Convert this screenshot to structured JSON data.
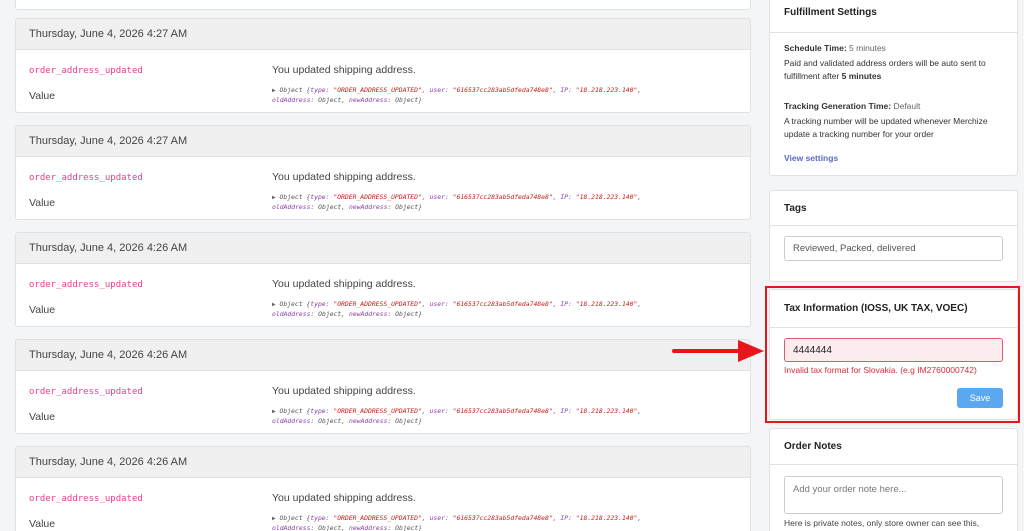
{
  "log": {
    "entries": [
      {
        "timestamp": "Thursday, June 4, 2026 4:27 AM",
        "event": "order_address_updated",
        "value_label": "Value",
        "description": "You updated shipping address."
      },
      {
        "timestamp": "Thursday, June 4, 2026 4:27 AM",
        "event": "order_address_updated",
        "value_label": "Value",
        "description": "You updated shipping address."
      },
      {
        "timestamp": "Thursday, June 4, 2026 4:26 AM",
        "event": "order_address_updated",
        "value_label": "Value",
        "description": "You updated shipping address."
      },
      {
        "timestamp": "Thursday, June 4, 2026 4:26 AM",
        "event": "order_address_updated",
        "value_label": "Value",
        "description": "You updated shipping address."
      },
      {
        "timestamp": "Thursday, June 4, 2026 4:26 AM",
        "event": "order_address_updated",
        "value_label": "Value",
        "description": "You updated shipping address."
      }
    ],
    "object_preview": {
      "prefix": "Object {",
      "type_key": "type: ",
      "type_val": "\"ORDER_ADDRESS_UPDATED\"",
      "user_key": ", user: ",
      "user_val": "\"616537cc283ab5dfeda748e8\"",
      "ip_key": ", IP: ",
      "ip_val": "\"18.218.223.140\"",
      "line2_old_key": "oldAddress",
      "line2_old_val": ": Object, ",
      "line2_new_key": "newAddress",
      "line2_new_val": ": Object}"
    }
  },
  "fulfillment": {
    "title": "Fulfillment Settings",
    "schedule_label": "Schedule Time:",
    "schedule_value": "5 minutes",
    "schedule_desc_prefix": "Paid and validated address orders will be auto sent to fulfillment after",
    "schedule_desc_bold": "5 minutes",
    "tracking_label": "Tracking Generation Time:",
    "tracking_value": "Default",
    "tracking_desc": "A tracking number will be updated whenever Merchize update a tracking number for your order",
    "view_settings": "View settings"
  },
  "tags": {
    "title": "Tags",
    "value": "Reviewed, Packed, delivered"
  },
  "tax": {
    "title": "Tax Information (IOSS, UK TAX, VOEC)",
    "value": "4444444",
    "error": "Invalid tax format for Slovakia. (e.g IM2760000742)",
    "save": "Save"
  },
  "notes": {
    "title": "Order Notes",
    "placeholder": "Add your order note here...",
    "hint": "Here is private notes, only store owner can see this,"
  },
  "colors": {
    "highlight": "#e8151b",
    "error": "#d92b3a",
    "event": "#e83e8c",
    "button": "#5aa9f0",
    "link": "#5c6ac4"
  }
}
